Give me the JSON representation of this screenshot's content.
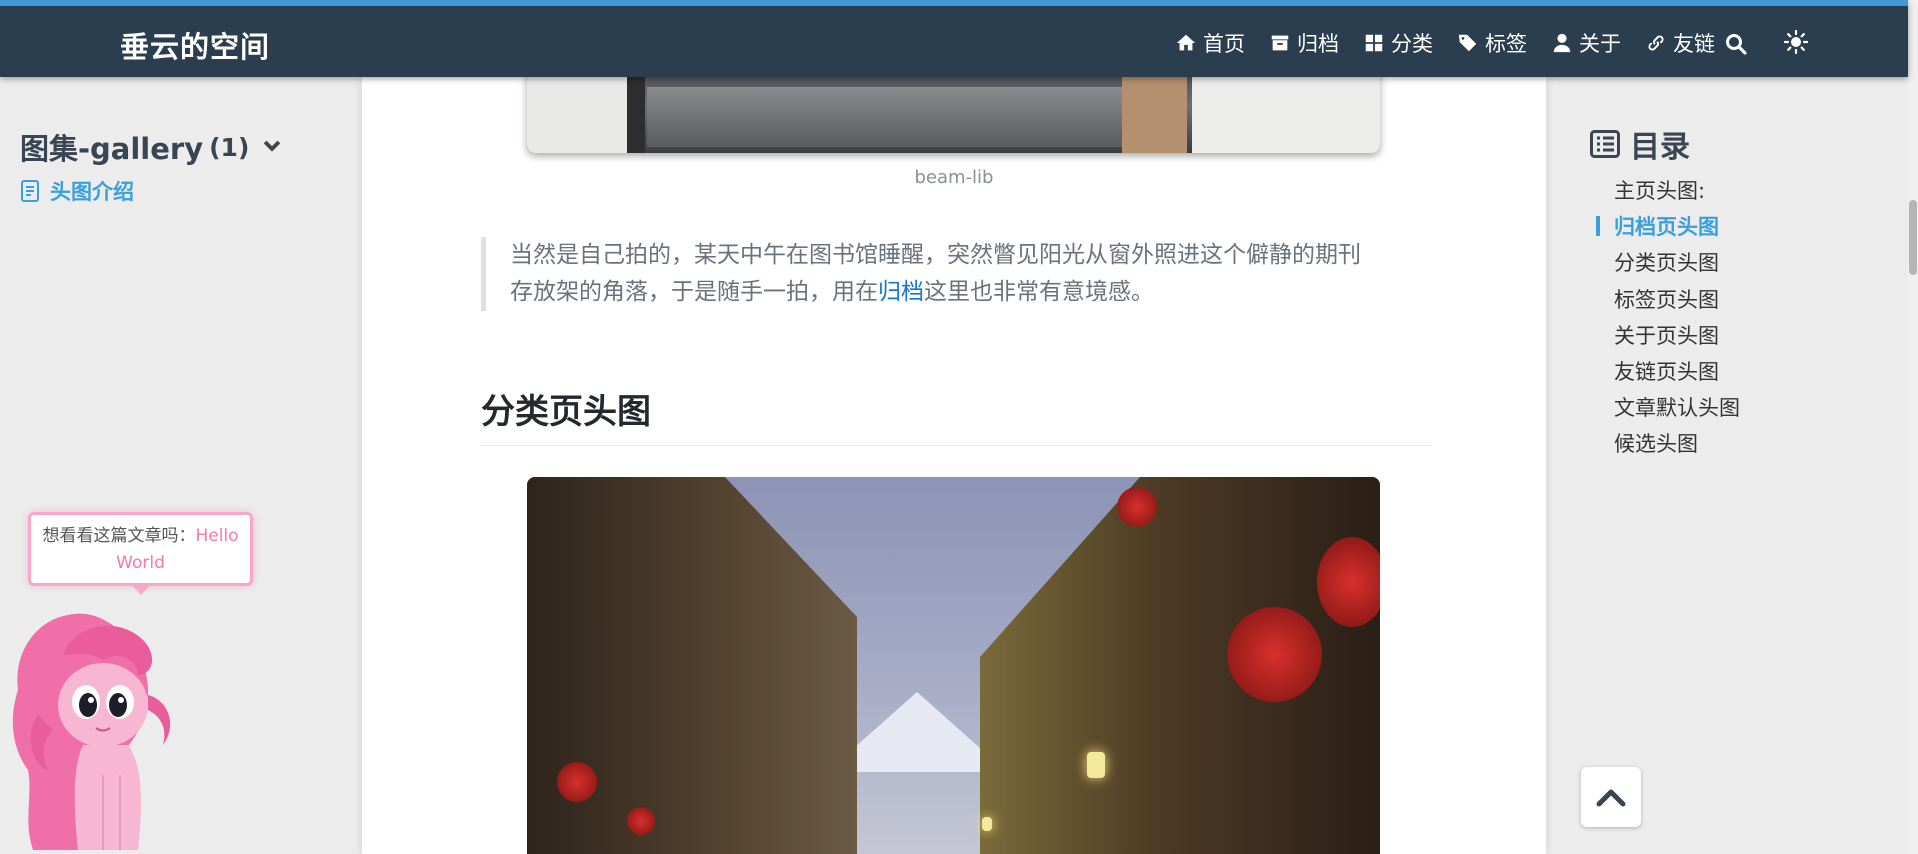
{
  "navbar": {
    "brand": "垂云的空间",
    "links": [
      {
        "label": "首页",
        "icon": "home-icon"
      },
      {
        "label": "归档",
        "icon": "archive-icon"
      },
      {
        "label": "分类",
        "icon": "grid-icon"
      },
      {
        "label": "标签",
        "icon": "tags-icon"
      },
      {
        "label": "关于",
        "icon": "user-icon"
      },
      {
        "label": "友链",
        "icon": "link-icon"
      }
    ],
    "search_icon": "search-icon",
    "theme_icon": "sun-icon",
    "accent_color": "#3f9ad6",
    "background_color": "#2b3e50"
  },
  "sidebar": {
    "category": "图集-gallery",
    "count": "(1)",
    "post": "头图介绍"
  },
  "article": {
    "image_caption": "beam-lib",
    "quote_before": "当然是自己拍的，某天中午在图书馆睡醒，突然瞥见阳光从窗外照进这个僻静的期刊存放架的角落，于是随手一拍，用在",
    "quote_link": "归档",
    "quote_after": "这里也非常有意境感。",
    "section_heading": "分类页头图",
    "link_color": "#1476d6"
  },
  "toc": {
    "title": "目录",
    "items": [
      {
        "label": "主页头图:"
      },
      {
        "label": "归档页头图",
        "active": true
      },
      {
        "label": "分类页头图"
      },
      {
        "label": "标签页头图"
      },
      {
        "label": "关于页头图"
      },
      {
        "label": "友链页头图"
      },
      {
        "label": "文章默认头图"
      },
      {
        "label": "候选头图"
      }
    ],
    "active_color": "#3aa0dc"
  },
  "mascot": {
    "prompt": "想看看这篇文章吗：",
    "suggestion": "Hello World",
    "highlight_color": "#f37ab0"
  }
}
